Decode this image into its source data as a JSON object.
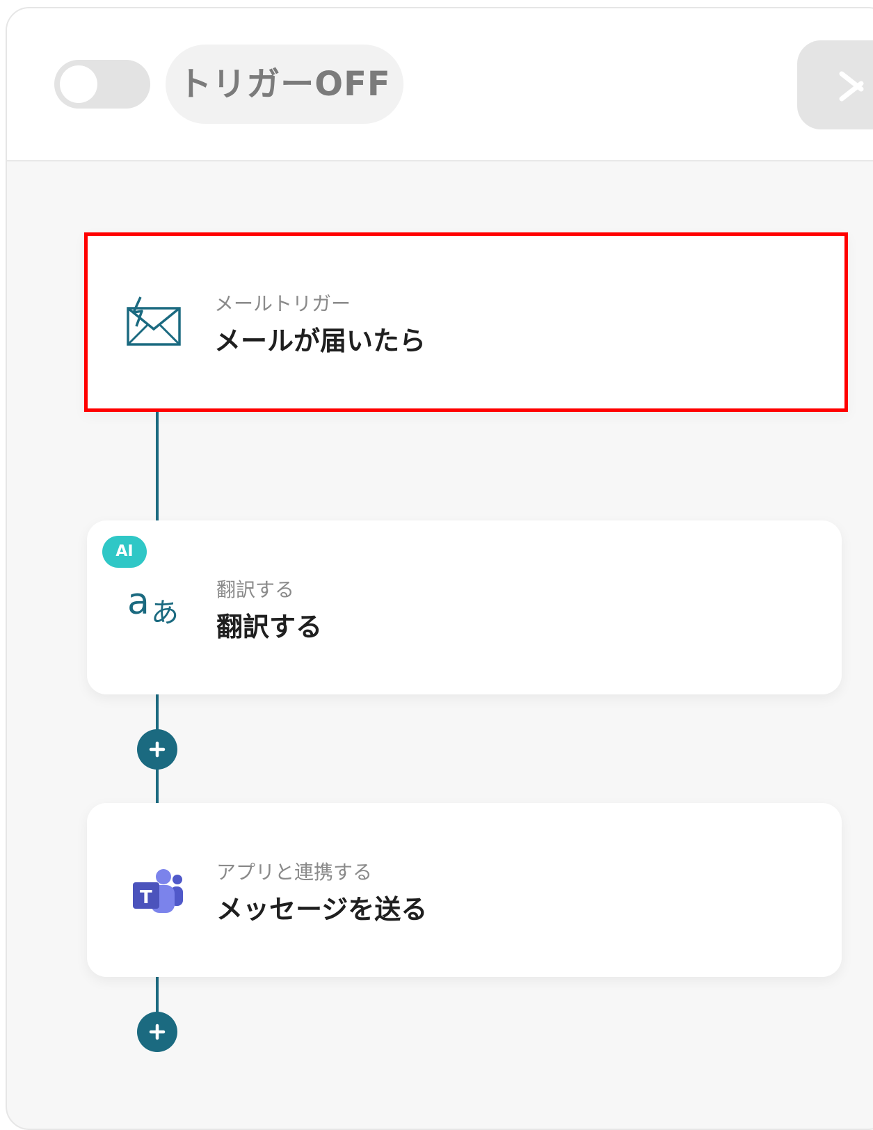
{
  "header": {
    "trigger_status": "トリガーOFF",
    "toggle_state": "off"
  },
  "flow": {
    "steps": [
      {
        "subtitle": "メールトリガー",
        "title": "メールが届いたら",
        "icon": "mail-trigger-icon",
        "selected": true
      },
      {
        "badge": "AI",
        "subtitle": "翻訳する",
        "title": "翻訳する",
        "icon": "translate-icon"
      },
      {
        "subtitle": "アプリと連携する",
        "title": "メッセージを送る",
        "icon": "microsoft-teams-icon"
      }
    ]
  },
  "colors": {
    "accent": "#1b6a80",
    "selection": "#ff0000",
    "ai_badge": "#2fc7c6",
    "teams": "#5059c9"
  }
}
